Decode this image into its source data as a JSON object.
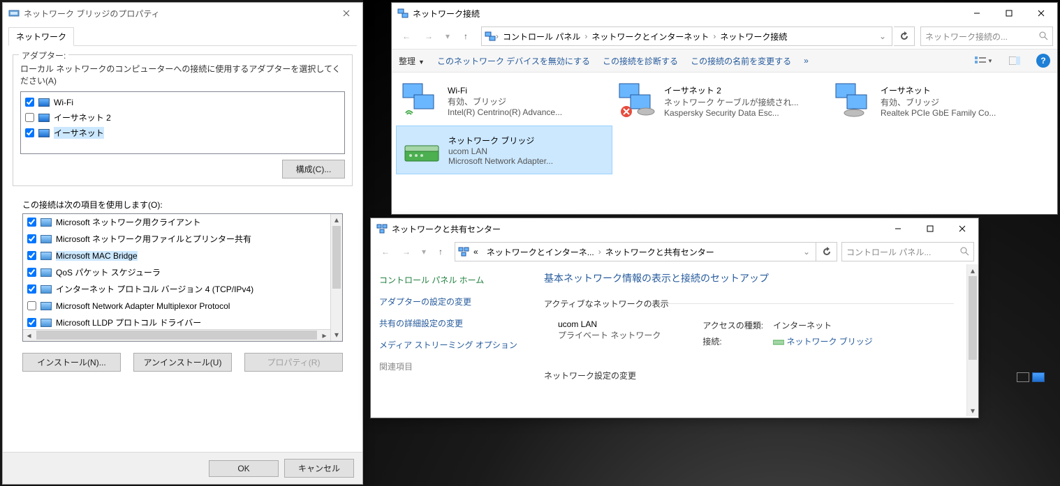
{
  "props_dialog": {
    "title": "ネットワーク ブリッジのプロパティ",
    "tab": "ネットワーク",
    "adapter_group": {
      "legend": "アダプター:",
      "instruction": "ローカル ネットワークのコンピューターへの接続に使用するアダプターを選択してください(A)",
      "adapters": [
        {
          "name": "Wi-Fi",
          "checked": true
        },
        {
          "name": "イーサネット 2",
          "checked": false
        },
        {
          "name": "イーサネット",
          "checked": true
        }
      ],
      "configure_btn": "構成(C)..."
    },
    "items_label": "この接続は次の項目を使用します(O):",
    "items": [
      {
        "name": "Microsoft ネットワーク用クライアント",
        "checked": true
      },
      {
        "name": "Microsoft ネットワーク用ファイルとプリンター共有",
        "checked": true
      },
      {
        "name": "Microsoft MAC Bridge",
        "checked": true,
        "selected": true
      },
      {
        "name": "QoS パケット スケジューラ",
        "checked": true
      },
      {
        "name": "インターネット プロトコル バージョン 4 (TCP/IPv4)",
        "checked": true
      },
      {
        "name": "Microsoft Network Adapter Multiplexor Protocol",
        "checked": false
      },
      {
        "name": "Microsoft LLDP プロトコル ドライバー",
        "checked": true
      }
    ],
    "install_btn": "インストール(N)...",
    "uninstall_btn": "アンインストール(U)",
    "properties_btn": "プロパティ(R)",
    "ok": "OK",
    "cancel": "キャンセル"
  },
  "explorer": {
    "title": "ネットワーク接続",
    "breadcrumbs": [
      "コントロール パネル",
      "ネットワークとインターネット",
      "ネットワーク接続"
    ],
    "search_placeholder": "ネットワーク接続の...",
    "commands": {
      "organize": "整理",
      "disable": "このネットワーク デバイスを無効にする",
      "diagnose": "この接続を診断する",
      "rename": "この接続の名前を変更する",
      "more": "»"
    },
    "connections": [
      {
        "name": "Wi-Fi",
        "status": "有効、ブリッジ",
        "device": "Intel(R) Centrino(R) Advance..."
      },
      {
        "name": "イーサネット 2",
        "status": "ネットワーク ケーブルが接続され...",
        "device": "Kaspersky Security Data Esc..."
      },
      {
        "name": "イーサネット",
        "status": "有効、ブリッジ",
        "device": "Realtek PCIe GbE Family Co..."
      },
      {
        "name": "ネットワーク ブリッジ",
        "status": "ucom LAN",
        "device": "Microsoft Network Adapter...",
        "selected": true
      }
    ]
  },
  "nsc": {
    "title": "ネットワークと共有センター",
    "breadcrumbs": [
      "«",
      "ネットワークとインターネ...",
      "ネットワークと共有センター"
    ],
    "search_placeholder": "コントロール パネル...",
    "left": {
      "home": "コントロール パネル ホーム",
      "links": [
        "アダプターの設定の変更",
        "共有の詳細設定の変更",
        "メディア ストリーミング オプション"
      ],
      "related": "関連項目"
    },
    "main": {
      "heading": "基本ネットワーク情報の表示と接続のセットアップ",
      "active_heading": "アクティブなネットワークの表示",
      "network_name": "ucom LAN",
      "network_type": "プライベート ネットワーク",
      "access_label": "アクセスの種類:",
      "access_value": "インターネット",
      "conn_label": "接続:",
      "conn_value": "ネットワーク ブリッジ",
      "settings_heading": "ネットワーク設定の変更"
    }
  }
}
